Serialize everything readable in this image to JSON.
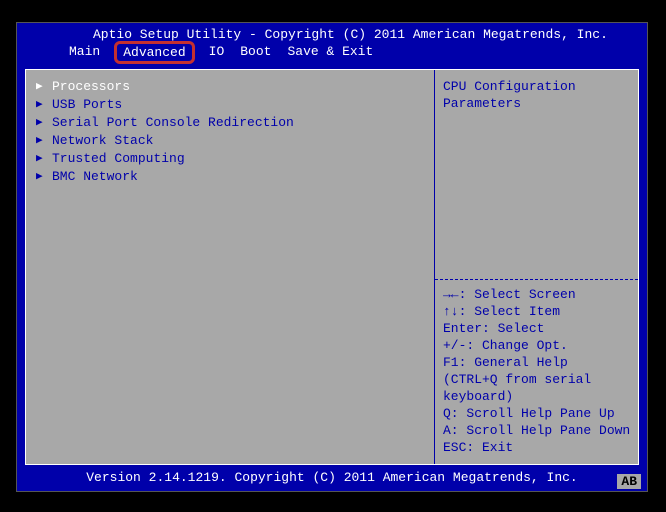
{
  "header": {
    "title": "Aptio Setup Utility - Copyright (C) 2011 American Megatrends, Inc."
  },
  "tabs": [
    "Main",
    "Advanced",
    "IO",
    "Boot",
    "Save & Exit"
  ],
  "active_tab_index": 1,
  "menu": [
    {
      "label": "Processors",
      "selected": true
    },
    {
      "label": "USB Ports",
      "selected": false
    },
    {
      "label": "Serial Port Console Redirection",
      "selected": false
    },
    {
      "label": "Network Stack",
      "selected": false
    },
    {
      "label": "Trusted Computing",
      "selected": false
    },
    {
      "label": "BMC Network",
      "selected": false
    }
  ],
  "help": {
    "context": [
      "CPU Configuration",
      "Parameters"
    ],
    "keys": [
      "→←: Select Screen",
      "↑↓: Select Item",
      "Enter: Select",
      "+/-: Change Opt.",
      "F1: General Help",
      "(CTRL+Q from serial",
      "keyboard)",
      "Q: Scroll Help Pane Up",
      "A: Scroll Help Pane Down",
      "ESC: Exit"
    ]
  },
  "footer": {
    "version": "Version 2.14.1219. Copyright (C) 2011 American Megatrends, Inc.",
    "badge": "AB"
  }
}
